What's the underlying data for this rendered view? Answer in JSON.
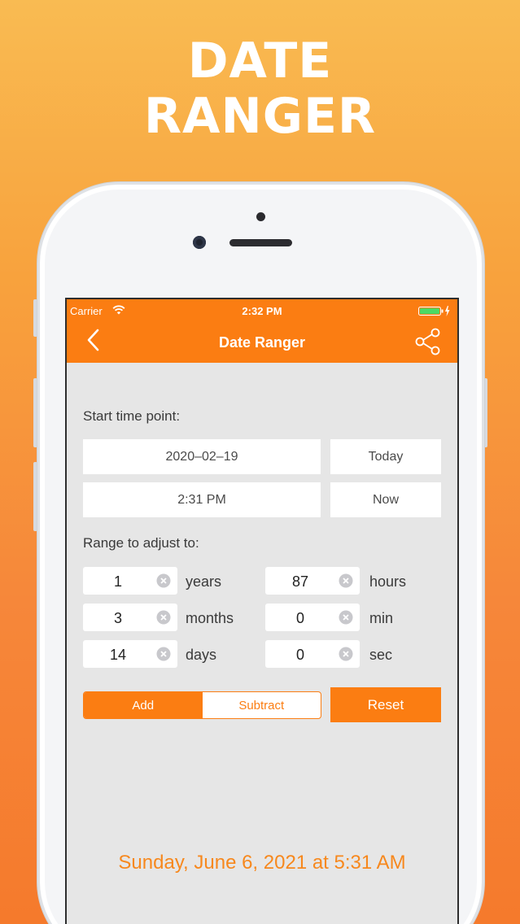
{
  "promo": {
    "line1": "DATE",
    "line2": "RANGER"
  },
  "status_bar": {
    "carrier": "Carrier",
    "time": "2:32 PM"
  },
  "nav": {
    "title": "Date Ranger",
    "back_icon": "chevron-left-icon",
    "share_icon": "share-icon"
  },
  "start": {
    "label": "Start time point:",
    "date_value": "2020–02–19",
    "time_value": "2:31 PM",
    "today_label": "Today",
    "now_label": "Now"
  },
  "range": {
    "label": "Range to adjust to:",
    "fields": [
      {
        "value": "1",
        "unit": "years"
      },
      {
        "value": "3",
        "unit": "months"
      },
      {
        "value": "14",
        "unit": "days"
      },
      {
        "value": "87",
        "unit": "hours"
      },
      {
        "value": "0",
        "unit": "min"
      },
      {
        "value": "0",
        "unit": "sec"
      }
    ]
  },
  "mode": {
    "add_label": "Add",
    "subtract_label": "Subtract",
    "selected": "Add"
  },
  "reset_label": "Reset",
  "result": "Sunday, June 6, 2021 at 5:31 AM",
  "colors": {
    "accent": "#fb7d12",
    "result": "#f7881d",
    "background": "#e6e6e6"
  }
}
